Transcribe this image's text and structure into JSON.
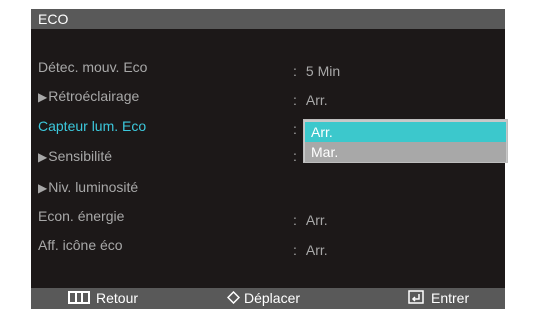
{
  "osd": {
    "title": "ECO",
    "items": [
      {
        "label": "Détec. mouv. Eco",
        "value": "5 Min",
        "submenu": false,
        "active": false
      },
      {
        "label": "Rétroéclairage",
        "value": "Arr.",
        "submenu": true,
        "active": false
      },
      {
        "label": "Capteur lum. Eco",
        "value": "",
        "submenu": false,
        "active": true
      },
      {
        "label": "Sensibilité",
        "value": "",
        "submenu": true,
        "active": false
      },
      {
        "label": "Niv. luminosité",
        "value": "",
        "submenu": true,
        "active": false
      },
      {
        "label": "Econ. énergie",
        "value": "Arr.",
        "submenu": false,
        "active": false
      },
      {
        "label": "Aff. icône éco",
        "value": "Arr.",
        "submenu": false,
        "active": false
      }
    ],
    "colon": ":",
    "submenu_marker": "▶",
    "dropdown": {
      "options": [
        "Arr.",
        "Mar."
      ],
      "selected": "Arr."
    }
  },
  "footer": {
    "back_label": "Retour",
    "move_label": "Déplacer",
    "enter_label": "Entrer",
    "back_icon": "menu-grid-icon",
    "move_icon": "navigate-diamond-icon",
    "enter_icon": "enter-return-icon"
  },
  "colors": {
    "background": "#1c1818",
    "header": "#595959",
    "text": "#a8a8a8",
    "accent": "#3cc8dc",
    "dropdown_selected": "#3cc8cc"
  }
}
